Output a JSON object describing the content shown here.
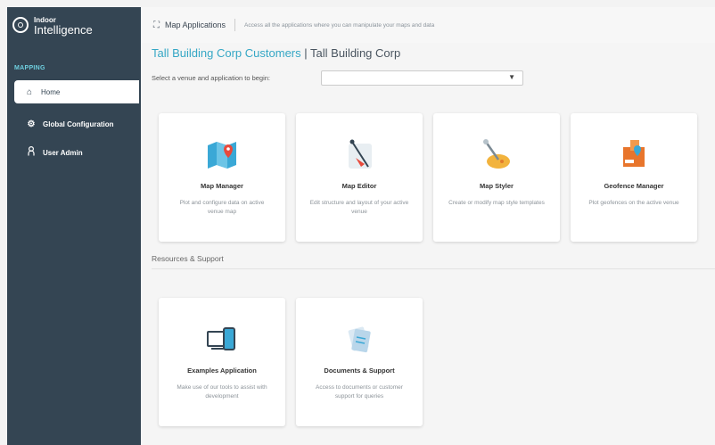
{
  "brand": {
    "line1": "Indoor",
    "line2": "Intelligence"
  },
  "sidebar": {
    "section": "MAPPING",
    "items": [
      {
        "label": "Home",
        "icon": "home-icon"
      },
      {
        "label": "Global Configuration",
        "icon": "gear-icon"
      },
      {
        "label": "User Admin",
        "icon": "user-icon"
      }
    ]
  },
  "header": {
    "title": "Map Applications",
    "description": "Access all the applications where you can manipulate your maps and data"
  },
  "breadcrumb": {
    "customer": "Tall Building Corp Customers",
    "separator": "|",
    "org": "Tall Building Corp"
  },
  "venue": {
    "label": "Select a venue and application to begin:",
    "value": ""
  },
  "apps": [
    {
      "name": "Map Manager",
      "desc": "Plot and configure data on active venue map",
      "icon": "map-manager-icon"
    },
    {
      "name": "Map Editor",
      "desc": "Edit structure and layout of your active venue",
      "icon": "map-editor-icon"
    },
    {
      "name": "Map Styler",
      "desc": "Create or modify map style templates",
      "icon": "map-styler-icon"
    },
    {
      "name": "Geofence Manager",
      "desc": "Plot geofences on the active venue",
      "icon": "geofence-icon"
    }
  ],
  "resources": {
    "title": "Resources & Support",
    "items": [
      {
        "name": "Examples Application",
        "desc": "Make use of our tools to assist with development",
        "icon": "devices-icon"
      },
      {
        "name": "Documents & Support",
        "desc": "Access to documents or customer support for queries",
        "icon": "documents-icon"
      }
    ]
  },
  "colors": {
    "sidebar": "#344553",
    "accent": "#35a7c5"
  }
}
